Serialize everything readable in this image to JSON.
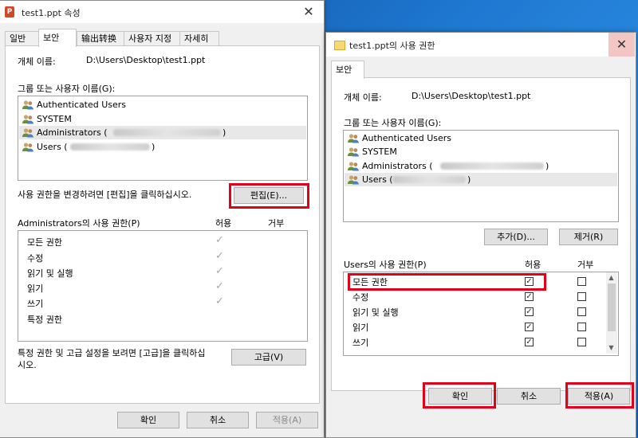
{
  "left_window": {
    "title": "test1.ppt 속성",
    "close_glyph": "✕",
    "app_icon_glyph": "P",
    "tabs": [
      "일반",
      "보안",
      "输出转换",
      "사용자 지정",
      "자세히"
    ],
    "object_name_label": "개체 이름:",
    "object_name_value": "D:\\Users\\Desktop\\test1.ppt",
    "group_label": "그룹 또는 사용자 이름(G):",
    "users": [
      {
        "name": "Authenticated Users",
        "icon": "users-icon"
      },
      {
        "name": "SYSTEM",
        "icon": "users-icon"
      },
      {
        "name": "Administrators (",
        "suffix": ")",
        "icon": "users-icon",
        "selected": true
      },
      {
        "name": "Users (",
        "suffix": ")",
        "icon": "users-icon"
      }
    ],
    "change_hint": "사용 권한을 변경하려면 [편집]을 클릭하십시오.",
    "edit_button": "편집(E)...",
    "perm_header": "Administrators의 사용 권한(P)",
    "allow_header": "허용",
    "deny_header": "거부",
    "permissions": [
      {
        "name": "모든 권한",
        "allow": true
      },
      {
        "name": "수정",
        "allow": true
      },
      {
        "name": "읽기 및 실행",
        "allow": true
      },
      {
        "name": "읽기",
        "allow": true
      },
      {
        "name": "쓰기",
        "allow": true
      },
      {
        "name": "특정 권한",
        "allow": false
      }
    ],
    "check_glyph": "✓",
    "advanced_hint_line1": "특정 권한 및 고급 설정을 보려면 [고급]을 클릭하십",
    "advanced_hint_line2": "시오.",
    "advanced_button": "고급(V)",
    "ok_button": "확인",
    "cancel_button": "취소",
    "apply_button": "적용(A)"
  },
  "right_window": {
    "title": "test1.ppt의 사용 권한",
    "close_glyph": "✕",
    "tab": "보안",
    "object_name_label": "개체 이름:",
    "object_name_value": "D:\\Users\\Desktop\\test1.ppt",
    "group_label": "그룹 또는 사용자 이름(G):",
    "users": [
      {
        "name": "Authenticated Users",
        "icon": "users-icon"
      },
      {
        "name": "SYSTEM",
        "icon": "users-icon"
      },
      {
        "name": "Administrators (",
        "suffix": ")",
        "icon": "users-icon"
      },
      {
        "name": "Users (",
        "suffix": ")",
        "icon": "users-icon",
        "selected": true
      }
    ],
    "add_button": "추가(D)...",
    "remove_button": "제거(R)",
    "perm_header": "Users의 사용 권한(P)",
    "allow_header": "허용",
    "deny_header": "거부",
    "permissions": [
      {
        "name": "모든 권한",
        "allow": true,
        "deny": false
      },
      {
        "name": "수정",
        "allow": true,
        "deny": false
      },
      {
        "name": "읽기 및 실행",
        "allow": true,
        "deny": false
      },
      {
        "name": "읽기",
        "allow": true,
        "deny": false
      },
      {
        "name": "쓰기",
        "allow": true,
        "deny": false
      }
    ],
    "checked_glyph": "✓",
    "scroll_up": "▲",
    "scroll_down": "▼",
    "ok_button": "확인",
    "cancel_button": "취소",
    "apply_button": "적용(A)"
  },
  "colors": {
    "highlight_red": "#e3001b",
    "dialog_bg": "#f0f0f0",
    "desktop_blue": "#1f78d1"
  }
}
